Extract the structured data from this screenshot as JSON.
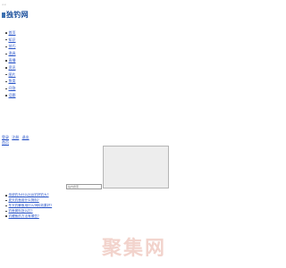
{
  "header": {
    "top_text": "<<",
    "site_title": "独钓网"
  },
  "nav": {
    "items": [
      {
        "label": "首页"
      },
      {
        "label": "知识"
      },
      {
        "label": "技巧"
      },
      {
        "label": "渔具"
      },
      {
        "label": "直播"
      },
      {
        "label": "资讯"
      },
      {
        "label": "图片"
      },
      {
        "label": "鱼类"
      },
      {
        "label": "问答"
      },
      {
        "label": "话题"
      }
    ]
  },
  "auth": {
    "login": "登录",
    "register": "注册",
    "logout": "退出",
    "home": "首页"
  },
  "search": {
    "placeholder": "站内搜索"
  },
  "links": {
    "items": [
      {
        "label": "传统钓为什么比台钓好钓大?"
      },
      {
        "label": "夏天钓鱼用什么饵料?"
      },
      {
        "label": "冬天钓鲫鱼用什么饵料效果好?"
      },
      {
        "label": "钓鱼窝料怎么打?"
      },
      {
        "label": "钓鲤鱼的方法有哪些?"
      }
    ]
  },
  "watermark": {
    "text": "聚集网"
  }
}
